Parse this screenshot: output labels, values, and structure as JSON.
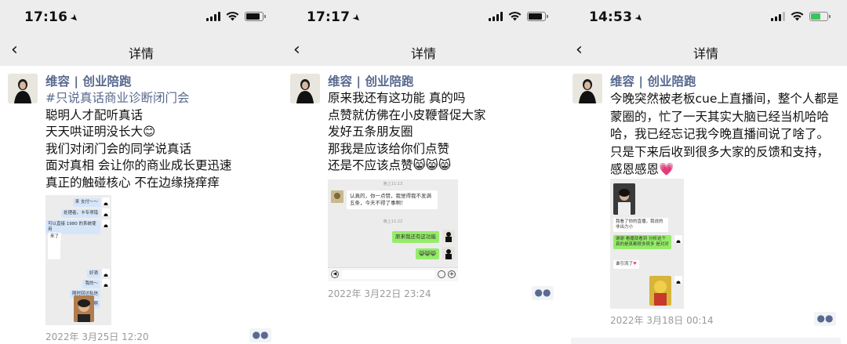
{
  "panels": [
    {
      "status": {
        "time": "17:16",
        "battery_level": 0.85,
        "charging": false
      },
      "nav": {
        "back_icon": "chevron-left-icon",
        "title": "详情"
      },
      "post": {
        "author": "维容 | 创业陪跑",
        "lines": [
          "#只说真话商业诊断闭门会",
          "聪明人才配听真话",
          "天天哄证明没长大😊",
          "我们对闭门会的同学说真话",
          "面对真相 会让你的商业成长更迅速",
          "真正的触碰核心 不在边缘挠痒痒"
        ],
        "screenshot": {
          "bubbles": [
            "来 支付～～",
            "处理者，卡专项错",
            "可以直接 1980 的系统使用",
            "来了",
            "好滴",
            "我的～",
            "随时回访私信",
            "好啊"
          ]
        },
        "timestamp": "2022年 3月25日 12:20"
      }
    },
    {
      "status": {
        "time": "17:17",
        "battery_level": 0.85,
        "charging": false
      },
      "nav": {
        "back_icon": "chevron-left-icon",
        "title": "详情"
      },
      "post": {
        "author": "维容 | 创业陪跑",
        "lines": [
          "原来我还有这功能 真的吗",
          "点赞就仿佛在小皮鞭督促大家",
          "发好五条朋友圈",
          "那我是应该给你们点赞",
          "还是不应该点赞😸😸😸"
        ],
        "screenshot": {
          "time1": "晚上11:13",
          "msg1": "认真的，你一点赞，我觉得我不发满五条，今天不得了事啊！",
          "time2": "晚上11:22",
          "msg2": "原来我还有这功能",
          "msg3": "😸😸😸"
        },
        "timestamp": "2022年 3月22日 23:24"
      }
    },
    {
      "status": {
        "time": "14:53",
        "battery_level": 0.6,
        "charging": true
      },
      "nav": {
        "back_icon": "chevron-left-icon",
        "title": "详情"
      },
      "post": {
        "author": "维容 | 创业陪跑",
        "lines": [
          "今晚突然被老板cue上直播间，整个人都是蒙圈的，忙了一天其实大脑已经当机哈哈哈，我已经忘记我今晚直播间说了啥了。只是下来后收到很多大家的反馈和支持，感恩感恩💗"
        ],
        "screenshot": {
          "msg1": "我看了你的直播，我说的非出力小",
          "msg2": "谢谢 看播就看到 分析这个真的是真都很多很多 是对对",
          "msg3": "谁引流了"
        },
        "timestamp": "2022年 3月18日 00:14"
      }
    }
  ]
}
